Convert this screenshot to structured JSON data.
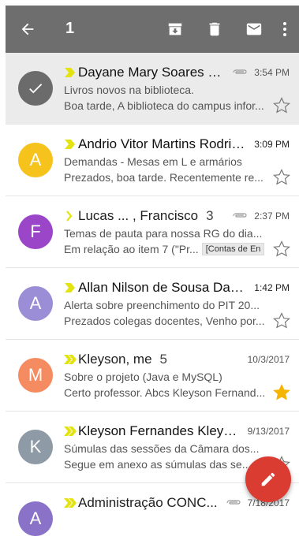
{
  "toolbar": {
    "selected_count": "1",
    "actions": [
      "back-arrow-icon",
      "archive-icon",
      "delete-icon",
      "mark-unread-icon",
      "more-vert-icon"
    ]
  },
  "colors": {
    "toolbar_bg": "#6e6e6e",
    "importance_marker": "#e3e312",
    "star_filled": "#f4b400",
    "fab": "#db3c32"
  },
  "emails": [
    {
      "avatar_letter": "",
      "avatar_color": "#6b6b6b",
      "selected": true,
      "sender": "Dayane Mary Soares da...",
      "count": "",
      "has_attachment": true,
      "time": "3:54 PM",
      "subject": "Livros novos na biblioteca.",
      "snippet": "Boa tarde, A biblioteca do campus infor...",
      "label": "",
      "starred": false,
      "marker": "single"
    },
    {
      "avatar_letter": "A",
      "avatar_color": "#f6c21c",
      "selected": false,
      "sender": "Andrio Vitor Martins Rodrig...",
      "count": "",
      "has_attachment": false,
      "time": "3:09 PM",
      "subject": "Demandas - Mesas em L e armários",
      "snippet": "Prezados, boa tarde. Recentemente re...",
      "label": "",
      "starred": false,
      "marker": "single"
    },
    {
      "avatar_letter": "F",
      "avatar_color": "#9b45c9",
      "selected": false,
      "sender": "Lucas ... , Francisco",
      "count": "3",
      "has_attachment": true,
      "time": "2:37 PM",
      "subject": "Temas de pauta para nossa RG do dia...",
      "snippet": "Em relação ao item 7 (\"Pr...",
      "label": "[Contas de En",
      "starred": false,
      "marker": "single-outline"
    },
    {
      "avatar_letter": "A",
      "avatar_color": "#9b8ed6",
      "selected": false,
      "sender": "Allan Nilson de Sousa Dant...",
      "count": "",
      "has_attachment": false,
      "time": "1:42 PM",
      "subject": "Alerta sobre preenchimento do PIT 20...",
      "snippet": "Prezados colegas docentes, Venho por...",
      "label": "",
      "starred": false,
      "marker": "single"
    },
    {
      "avatar_letter": "M",
      "avatar_color": "#f48b61",
      "selected": false,
      "sender": "Kleyson, me",
      "count": "5",
      "has_attachment": false,
      "time": "10/3/2017",
      "subject": "Sobre o projeto (Java e MySQL)",
      "snippet": "Certo professor. Abcs Kleyson Fernand...",
      "label": "",
      "starred": true,
      "marker": "double"
    },
    {
      "avatar_letter": "K",
      "avatar_color": "#8e9aa6",
      "selected": false,
      "sender": "Kleyson Fernandes Kleys...",
      "count": "",
      "has_attachment": false,
      "time": "9/13/2017",
      "subject": "Súmulas das sessões da Câmara dos...",
      "snippet": "Segue em anexo as súmulas das se...",
      "label": "",
      "starred": false,
      "marker": "double"
    },
    {
      "avatar_letter": "A",
      "avatar_color": "#8a72c9",
      "selected": false,
      "sender": "Administração CONC...",
      "count": "",
      "has_attachment": true,
      "time": "7/18/2017",
      "subject": "",
      "snippet": "",
      "label": "",
      "starred": false,
      "marker": "double"
    }
  ]
}
